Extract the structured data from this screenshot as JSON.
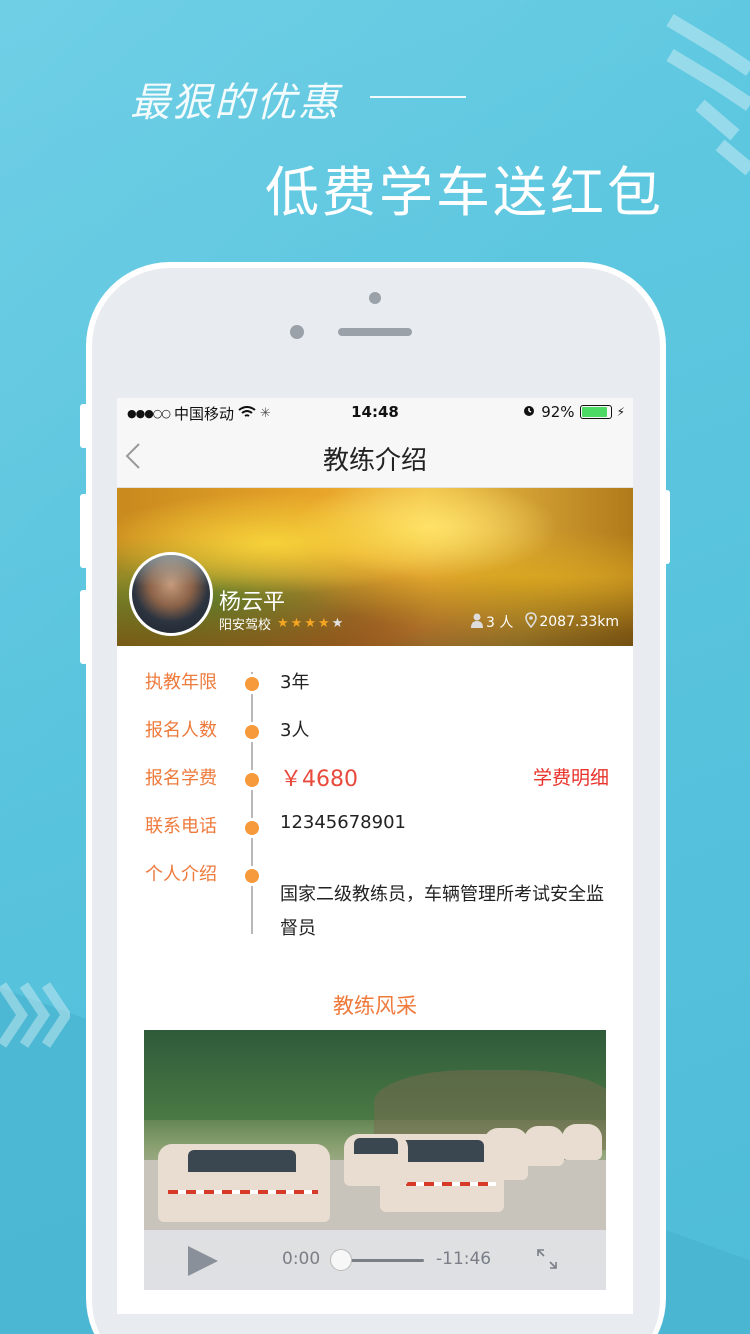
{
  "promo": {
    "slogan_line1": "最狠的优惠",
    "slogan_line2": "低费学车送红包"
  },
  "statusbar": {
    "signal": "●●●○○",
    "carrier": "中国移动",
    "time": "14:48",
    "battery_percent": "92%",
    "battery_level": 0.92
  },
  "navbar": {
    "back_icon": "chevron-left-icon",
    "title": "教练介绍"
  },
  "coach": {
    "name": "杨云平",
    "school": "阳安驾校",
    "rating": 4,
    "rating_max": 5,
    "students": "3 人",
    "distance": "2087.33km"
  },
  "info": {
    "rows": [
      {
        "label": "执教年限",
        "value": "3年"
      },
      {
        "label": "报名人数",
        "value": "3人"
      },
      {
        "label": "报名学费",
        "value": "￥4680",
        "link": "学费明细"
      },
      {
        "label": "联系电话",
        "value": "12345678901"
      },
      {
        "label": "个人介绍",
        "value": "国家二级教练员，车辆管理所考试安全监督员"
      }
    ]
  },
  "gallery": {
    "title": "教练风采",
    "video": {
      "current_time": "0:00",
      "remaining_time": "-11:46",
      "progress": 0
    }
  },
  "colors": {
    "background": "#5cc6df",
    "label_orange": "#ee7a3c",
    "dot_orange": "#f69a3c",
    "price_red": "#e84a3c",
    "link_red": "#e8322a"
  }
}
